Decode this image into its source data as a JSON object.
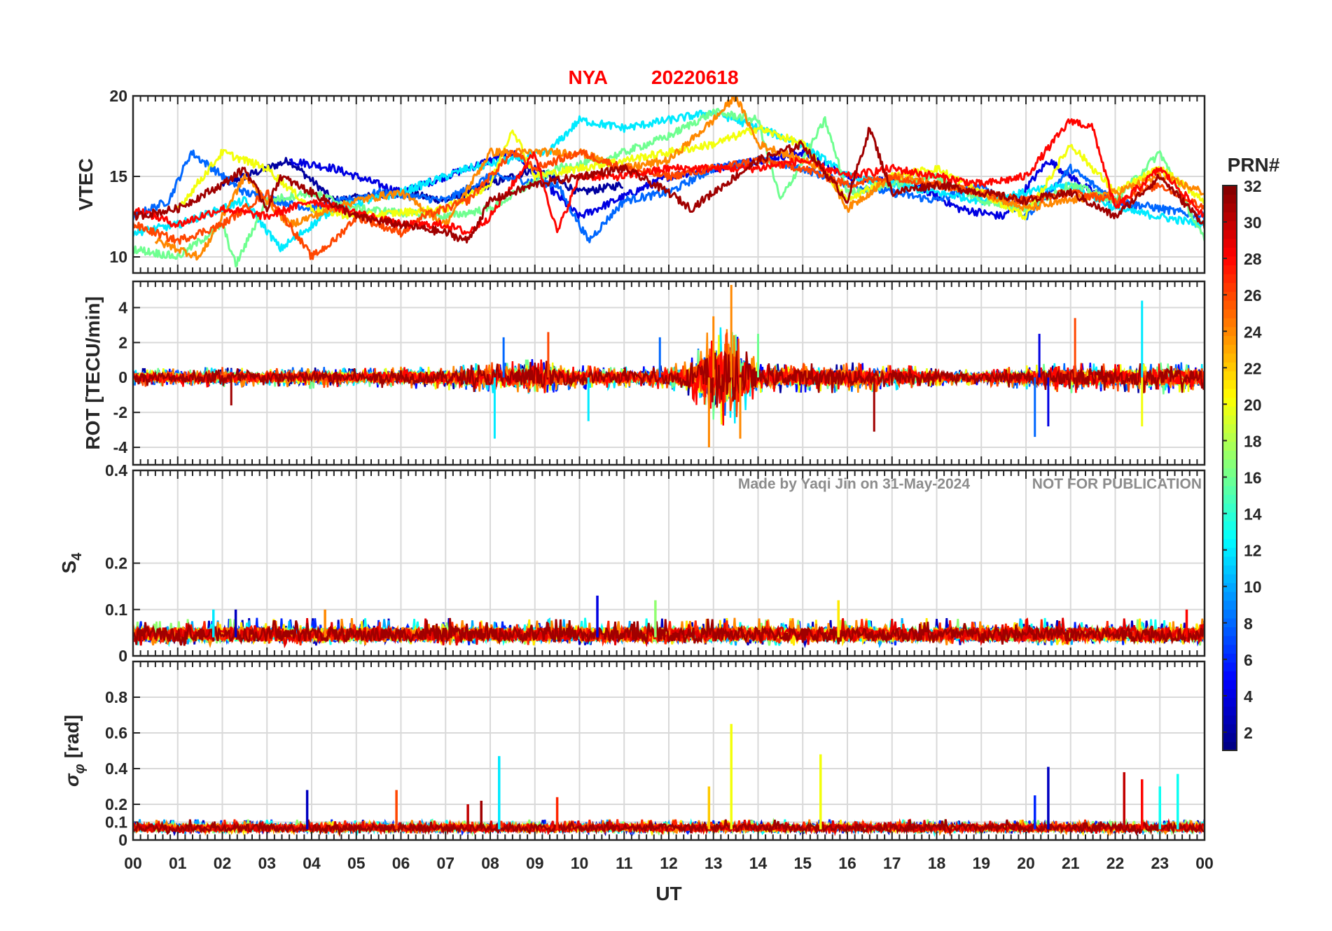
{
  "chart_data": {
    "type": "line",
    "title_station": "NYA",
    "title_date": "20220618",
    "xlabel": "UT",
    "x_range_hours": [
      0,
      24
    ],
    "x_ticks": [
      "00",
      "01",
      "02",
      "03",
      "04",
      "05",
      "06",
      "07",
      "08",
      "09",
      "10",
      "11",
      "12",
      "13",
      "14",
      "15",
      "16",
      "17",
      "18",
      "19",
      "20",
      "21",
      "22",
      "23",
      "00"
    ],
    "grid": true,
    "watermark_left": "Made by Yaqi Jin on 31-May-2024",
    "watermark_right": "NOT FOR PUBLICATION",
    "colorbar": {
      "label": "PRN#",
      "range": [
        1,
        32
      ],
      "colormap": "jet",
      "ticks": [
        "2",
        "4",
        "6",
        "8",
        "10",
        "12",
        "14",
        "16",
        "18",
        "20",
        "22",
        "24",
        "26",
        "28",
        "30",
        "32"
      ],
      "tick_values": [
        2,
        4,
        6,
        8,
        10,
        12,
        14,
        16,
        18,
        20,
        22,
        24,
        26,
        28,
        30,
        32
      ]
    },
    "panels": [
      {
        "id": "vtec",
        "ylabel": "VTEC",
        "ylim": [
          9,
          20
        ],
        "yticks": [
          "10",
          "15",
          "20"
        ],
        "ytick_values": [
          10,
          15,
          20
        ],
        "series": [
          {
            "prn": 2,
            "t": [
              2.0,
              3.5,
              4.5,
              6,
              7,
              8,
              9,
              10,
              11
            ],
            "v": [
              14.5,
              16.0,
              13.5,
              14.0,
              13.5,
              14.5,
              15.5,
              14.0,
              14.5
            ]
          },
          {
            "prn": 4,
            "t": [
              3.5,
              4.5,
              6,
              8.5,
              10,
              12,
              13,
              14,
              15,
              16,
              17.5,
              18.5,
              19.5,
              20.5,
              21.5,
              22.5
            ],
            "v": [
              16.0,
              15.5,
              14.0,
              16.5,
              12.5,
              15.0,
              15.5,
              16.0,
              16.5,
              15.0,
              14.5,
              13.0,
              12.5,
              16.0,
              14.0,
              13.0
            ]
          },
          {
            "prn": 8,
            "t": [
              0,
              0.8,
              1.3,
              2.5,
              4,
              5.5,
              7,
              8,
              9.5,
              10.2,
              11,
              12,
              13,
              14,
              15,
              16,
              17,
              18,
              19,
              20,
              21,
              22,
              23,
              24
            ],
            "v": [
              12.5,
              13.5,
              16.5,
              14.0,
              13.0,
              14.0,
              13.5,
              15.0,
              14.5,
              11.0,
              13.5,
              14.0,
              15.5,
              16.0,
              15.5,
              14.5,
              14.0,
              13.5,
              14.5,
              12.5,
              15.5,
              13.5,
              13.0,
              12.5
            ]
          },
          {
            "prn": 12,
            "t": [
              0,
              1,
              2.5,
              3.3,
              4.5,
              6,
              7.5,
              9.3,
              10,
              11,
              12,
              13,
              14,
              15,
              16,
              17,
              18,
              19,
              20,
              21,
              22,
              23,
              24
            ],
            "v": [
              11.5,
              12.0,
              13.5,
              10.5,
              13.0,
              14.0,
              15.5,
              16.5,
              18.5,
              18.0,
              18.5,
              19.0,
              18.0,
              17.0,
              15.0,
              14.5,
              14.0,
              13.5,
              14.0,
              14.5,
              13.0,
              12.5,
              12.0
            ]
          },
          {
            "prn": 16,
            "t": [
              0,
              1,
              2,
              2.3,
              3,
              4,
              5,
              7,
              8,
              9.5,
              10.5,
              12,
              13,
              14,
              14.5,
              15.5,
              16,
              17,
              18,
              19,
              20,
              21,
              22,
              23,
              24
            ],
            "v": [
              10.5,
              10.0,
              12.0,
              9.5,
              13.5,
              14.0,
              13.0,
              12.5,
              13.0,
              15.5,
              16.0,
              17.5,
              19.0,
              18.5,
              13.5,
              18.5,
              14.0,
              14.5,
              15.0,
              13.5,
              13.0,
              14.5,
              13.5,
              16.5,
              11.0
            ]
          },
          {
            "prn": 20,
            "t": [
              1,
              2,
              3,
              4,
              5,
              7,
              8,
              8.5,
              9,
              10,
              11,
              12,
              13,
              14,
              15,
              16,
              17,
              18,
              19,
              20,
              21,
              22,
              23,
              24
            ],
            "v": [
              13.0,
              16.5,
              15.5,
              13.0,
              12.5,
              13.0,
              14.5,
              18.0,
              15.0,
              15.5,
              16.0,
              16.5,
              17.0,
              18.0,
              17.0,
              13.5,
              15.0,
              15.5,
              14.0,
              12.5,
              17.0,
              14.0,
              15.5,
              13.5
            ]
          },
          {
            "prn": 24,
            "t": [
              0.5,
              1.5,
              2.5,
              3.5,
              5,
              6,
              7,
              8,
              10,
              11,
              12,
              13,
              13.5,
              14,
              15,
              15.5,
              16,
              17,
              18,
              19,
              20,
              21,
              22,
              23,
              24
            ],
            "v": [
              11.0,
              10.0,
              15.0,
              12.0,
              13.5,
              14.0,
              12.0,
              16.5,
              16.5,
              15.5,
              16.0,
              18.5,
              20.0,
              17.0,
              16.0,
              15.5,
              13.0,
              15.0,
              14.5,
              14.0,
              13.0,
              13.5,
              14.0,
              15.0,
              14.0
            ]
          },
          {
            "prn": 26,
            "t": [
              0,
              1,
              2,
              3,
              4,
              4.5,
              5,
              6,
              6.5,
              7.5,
              8.5,
              9,
              10,
              11,
              12,
              13,
              14,
              15,
              16,
              17,
              18,
              19,
              20,
              21,
              22,
              23,
              24
            ],
            "v": [
              12.0,
              11.0,
              12.0,
              14.0,
              10.0,
              11.0,
              12.5,
              11.5,
              12.5,
              13.5,
              16.5,
              15.5,
              16.5,
              15.5,
              15.0,
              15.5,
              16.0,
              15.5,
              14.5,
              15.0,
              14.5,
              14.0,
              13.5,
              14.0,
              13.5,
              14.5,
              13.0
            ]
          },
          {
            "prn": 28,
            "t": [
              0,
              1,
              2,
              3,
              4,
              6,
              7,
              7.5,
              8,
              9,
              9.5,
              10,
              11,
              12,
              13,
              14,
              15,
              16,
              17,
              18,
              19,
              20,
              21,
              21.5,
              22,
              23,
              24
            ],
            "v": [
              13.0,
              12.0,
              13.0,
              12.5,
              13.5,
              12.0,
              12.0,
              11.5,
              12.5,
              16.5,
              11.5,
              15.0,
              15.0,
              15.5,
              15.5,
              15.5,
              16.0,
              15.0,
              15.5,
              15.0,
              14.5,
              15.0,
              18.5,
              18.0,
              13.0,
              15.5,
              12.5
            ]
          },
          {
            "prn": 31,
            "t": [
              0,
              1,
              2,
              2.5,
              3,
              3.3,
              4,
              5,
              6,
              7,
              7.5,
              8,
              9,
              10,
              11,
              12,
              12.5,
              14,
              15,
              16,
              16.5,
              17,
              18,
              19,
              20,
              21,
              22,
              23,
              24
            ],
            "v": [
              12.5,
              13.0,
              14.5,
              15.5,
              13.0,
              15.0,
              14.0,
              12.5,
              12.0,
              11.5,
              11.0,
              13.5,
              14.5,
              15.0,
              15.5,
              14.0,
              13.0,
              16.0,
              17.0,
              13.5,
              18.0,
              14.0,
              14.5,
              14.0,
              13.5,
              14.0,
              12.5,
              15.0,
              12.0
            ]
          }
        ]
      },
      {
        "id": "rot",
        "ylabel": "ROT [TECU/min]",
        "ylim": [
          -5,
          5.5
        ],
        "yticks": [
          "-4",
          "-2",
          "0",
          "2",
          "4"
        ],
        "ytick_values": [
          -4,
          -2,
          0,
          2,
          4
        ],
        "noise_profile": {
          "hours": [
            0,
            1,
            2,
            3,
            4,
            5,
            6,
            7,
            8,
            9,
            10,
            11,
            12,
            12.5,
            13,
            13.5,
            14,
            15,
            16,
            17,
            18,
            19,
            20,
            21,
            22,
            23,
            24
          ],
          "amplitude": [
            0.6,
            0.6,
            0.7,
            0.6,
            0.7,
            0.6,
            0.7,
            0.8,
            1.0,
            1.2,
            0.8,
            0.7,
            0.8,
            1.2,
            3.5,
            3.0,
            1.0,
            1.0,
            1.0,
            0.9,
            0.6,
            0.5,
            0.8,
            1.0,
            0.9,
            1.1,
            0.9
          ]
        },
        "spikes": [
          {
            "t": 2.2,
            "v": -1.6,
            "prn": 31
          },
          {
            "t": 8.1,
            "v": -3.5,
            "prn": 12
          },
          {
            "t": 8.3,
            "v": 2.3,
            "prn": 8
          },
          {
            "t": 10.2,
            "v": -2.5,
            "prn": 12
          },
          {
            "t": 12.9,
            "v": -4.0,
            "prn": 24
          },
          {
            "t": 13.0,
            "v": 3.5,
            "prn": 24
          },
          {
            "t": 13.4,
            "v": 5.3,
            "prn": 24
          },
          {
            "t": 13.6,
            "v": -3.5,
            "prn": 24
          },
          {
            "t": 16.6,
            "v": -3.1,
            "prn": 31
          },
          {
            "t": 20.2,
            "v": -3.4,
            "prn": 8
          },
          {
            "t": 20.5,
            "v": -2.8,
            "prn": 4
          },
          {
            "t": 21.1,
            "v": 3.4,
            "prn": 26
          },
          {
            "t": 22.6,
            "v": 4.4,
            "prn": 12
          },
          {
            "t": 22.6,
            "v": -2.8,
            "prn": 20
          },
          {
            "t": 20.3,
            "v": 2.5,
            "prn": 4
          },
          {
            "t": 11.8,
            "v": 2.3,
            "prn": 8
          },
          {
            "t": 9.3,
            "v": 2.6,
            "prn": 26
          },
          {
            "t": 14.0,
            "v": 2.5,
            "prn": 16
          }
        ]
      },
      {
        "id": "s4",
        "ylabel": "S",
        "ylabel_sub": "4",
        "ylim": [
          0,
          0.4
        ],
        "yticks": [
          "0",
          "0.1",
          "0.2",
          "0.4"
        ],
        "ytick_values": [
          0,
          0.1,
          0.2,
          0.4
        ],
        "baseline": 0.04,
        "amplitude": 0.03,
        "spikes": [
          {
            "t": 2.3,
            "v": 0.1,
            "prn": 3
          },
          {
            "t": 10.4,
            "v": 0.13,
            "prn": 4
          },
          {
            "t": 11.7,
            "v": 0.12,
            "prn": 17
          },
          {
            "t": 15.8,
            "v": 0.12,
            "prn": 21
          },
          {
            "t": 23.6,
            "v": 0.1,
            "prn": 28
          },
          {
            "t": 1.8,
            "v": 0.1,
            "prn": 12
          },
          {
            "t": 4.3,
            "v": 0.1,
            "prn": 24
          }
        ]
      },
      {
        "id": "sigphi",
        "ylabel": "σ",
        "ylabel_sub": "φ",
        "ylabel_unit": "[rad]",
        "ylim": [
          0,
          1.0
        ],
        "yticks": [
          "0",
          "0.1",
          "0.2",
          "0.4",
          "0.6",
          "0.8"
        ],
        "ytick_values": [
          0,
          0.1,
          0.2,
          0.4,
          0.6,
          0.8
        ],
        "baseline": 0.06,
        "amplitude": 0.04,
        "spikes": [
          {
            "t": 3.9,
            "v": 0.28,
            "prn": 3
          },
          {
            "t": 5.9,
            "v": 0.28,
            "prn": 26
          },
          {
            "t": 8.2,
            "v": 0.47,
            "prn": 12
          },
          {
            "t": 12.9,
            "v": 0.3,
            "prn": 22
          },
          {
            "t": 13.4,
            "v": 0.65,
            "prn": 20
          },
          {
            "t": 15.4,
            "v": 0.48,
            "prn": 20
          },
          {
            "t": 20.5,
            "v": 0.41,
            "prn": 3
          },
          {
            "t": 20.2,
            "v": 0.25,
            "prn": 6
          },
          {
            "t": 22.2,
            "v": 0.38,
            "prn": 30
          },
          {
            "t": 22.6,
            "v": 0.34,
            "prn": 28
          },
          {
            "t": 23.4,
            "v": 0.37,
            "prn": 13
          },
          {
            "t": 9.5,
            "v": 0.24,
            "prn": 27
          },
          {
            "t": 7.5,
            "v": 0.2,
            "prn": 30
          },
          {
            "t": 7.8,
            "v": 0.22,
            "prn": 31
          },
          {
            "t": 23.0,
            "v": 0.3,
            "prn": 13
          }
        ]
      }
    ]
  }
}
